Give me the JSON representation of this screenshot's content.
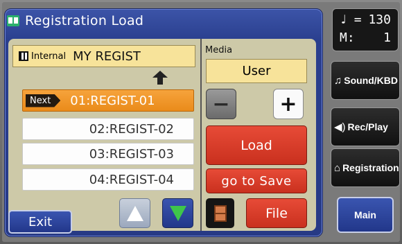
{
  "title": "Registration Load",
  "internal": {
    "label": "Internal",
    "name": "MY REGIST"
  },
  "list": {
    "next_tag": "Next",
    "rows": [
      "01:REGIST-01",
      "02:REGIST-02",
      "03:REGIST-03",
      "04:REGIST-04"
    ]
  },
  "media": {
    "label": "Media",
    "value": "User"
  },
  "buttons": {
    "minus": "−",
    "plus": "+",
    "load": "Load",
    "go_to_save": "go to Save",
    "file": "File",
    "exit": "Exit"
  },
  "tempo": {
    "note": "♩",
    "eq": "=",
    "bpm": "130",
    "measure_label": "M:",
    "measure": "1"
  },
  "sidebar": {
    "sound": "Sound/KBD",
    "rec": "Rec/Play",
    "registration": "Registration",
    "main": "Main"
  },
  "icons": {
    "title": "book-icon",
    "internal": "keyboard-icon",
    "up_indicator": "up-arrow-icon",
    "drawer": "drawer-icon",
    "sound": "note-icon",
    "rec": "speaker-icon",
    "registration": "registration-icon"
  },
  "colors": {
    "panel": "#273a85",
    "content": "#cdc9a8",
    "selected_row": "#ea8b1a",
    "display_field": "#f7e39a",
    "action_red": "#c9301e"
  }
}
